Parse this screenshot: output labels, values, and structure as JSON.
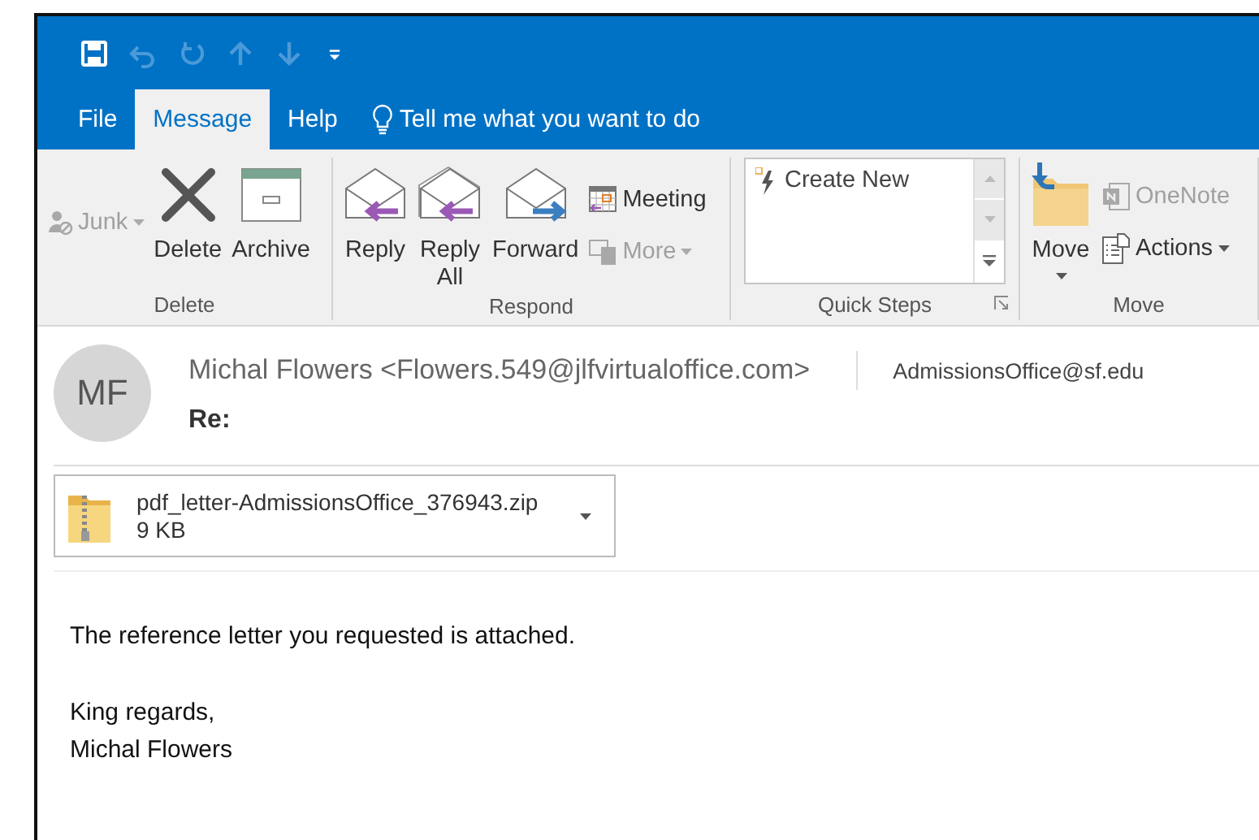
{
  "quick_access": [
    {
      "kind": "save",
      "disabled": false
    },
    {
      "kind": "undo",
      "disabled": true
    },
    {
      "kind": "redo",
      "disabled": true
    },
    {
      "kind": "up",
      "disabled": true
    },
    {
      "kind": "down",
      "disabled": true
    },
    {
      "kind": "customize",
      "disabled": false
    }
  ],
  "tabs": [
    {
      "label": "File",
      "selected": false
    },
    {
      "label": "Message",
      "selected": true
    },
    {
      "label": "Help",
      "selected": false
    }
  ],
  "tell_me": {
    "placeholder": "Tell me what you want to do"
  },
  "ribbon_groups": [
    {
      "label": "Delete",
      "launcher": false,
      "commands": [
        {
          "kind": "junk",
          "label": "Junk",
          "disabled": true,
          "dropdown": true
        },
        {
          "kind": "delete",
          "label": "Delete",
          "disabled": false,
          "dropdown": false
        },
        {
          "kind": "archive",
          "label": "Archive",
          "disabled": false,
          "dropdown": false
        }
      ]
    },
    {
      "label": "Respond",
      "launcher": false,
      "commands": [
        {
          "kind": "reply",
          "label": "Reply",
          "disabled": false,
          "dropdown": false
        },
        {
          "kind": "reply_all",
          "label": "Reply All",
          "disabled": false,
          "dropdown": false
        },
        {
          "kind": "forward",
          "label": "Forward",
          "disabled": false,
          "dropdown": false
        },
        {
          "kind": "meeting",
          "label": "Meeting",
          "disabled": false,
          "dropdown": false
        },
        {
          "kind": "more",
          "label": "More",
          "disabled": true,
          "dropdown": true
        }
      ]
    },
    {
      "label": "Quick Steps",
      "launcher": true,
      "commands": [
        {
          "kind": "gallery",
          "label": "Create New",
          "disabled": false
        }
      ]
    },
    {
      "label": "Move",
      "launcher": false,
      "commands": [
        {
          "kind": "move",
          "label": "Move",
          "disabled": false,
          "dropdown": true
        },
        {
          "kind": "onenote",
          "label": "OneNote",
          "disabled": true,
          "dropdown": false
        },
        {
          "kind": "actions",
          "label": "Actions",
          "disabled": false,
          "dropdown": true
        }
      ]
    }
  ],
  "message": {
    "avatar_initials": "MF",
    "from": "Michal Flowers <Flowers.549@jlfvirtualoffice.com>",
    "to": "AdmissionsOffice@sf.edu",
    "subject": "Re:",
    "attachment": {
      "name": "pdf_letter-AdmissionsOffice_376943.zip",
      "size": "9 KB"
    },
    "body": [
      "The reference letter you requested is attached.",
      "King regards,\nMichal Flowers"
    ]
  }
}
